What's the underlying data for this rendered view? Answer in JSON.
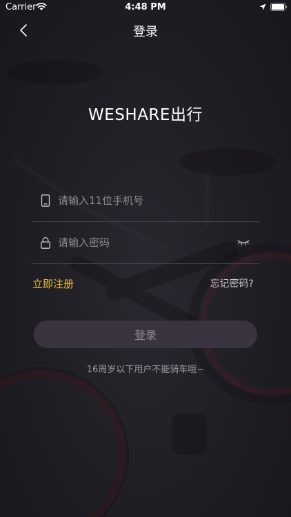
{
  "status_bar": {
    "carrier": "Carrier",
    "time": "4:48 PM"
  },
  "nav": {
    "title": "登录"
  },
  "brand": {
    "title": "WESHARE出行"
  },
  "form": {
    "phone_placeholder": "请输入11位手机号",
    "phone_value": "",
    "password_placeholder": "请输入密码",
    "password_value": ""
  },
  "links": {
    "register": "立即注册",
    "forgot_password": "忘记密码?"
  },
  "login_button": {
    "label": "登录"
  },
  "notice": "16周岁以下用户不能骑车哦~",
  "colors": {
    "background": "#1f1e24",
    "accent": "#e8b93a",
    "button_bg": "#3a3440",
    "divider": "#45434b"
  },
  "icons": {
    "back": "chevron-left-icon",
    "phone": "phone-icon",
    "lock": "lock-icon",
    "eye": "eye-closed-icon",
    "wifi": "wifi-icon",
    "location": "location-icon",
    "battery": "battery-icon"
  }
}
